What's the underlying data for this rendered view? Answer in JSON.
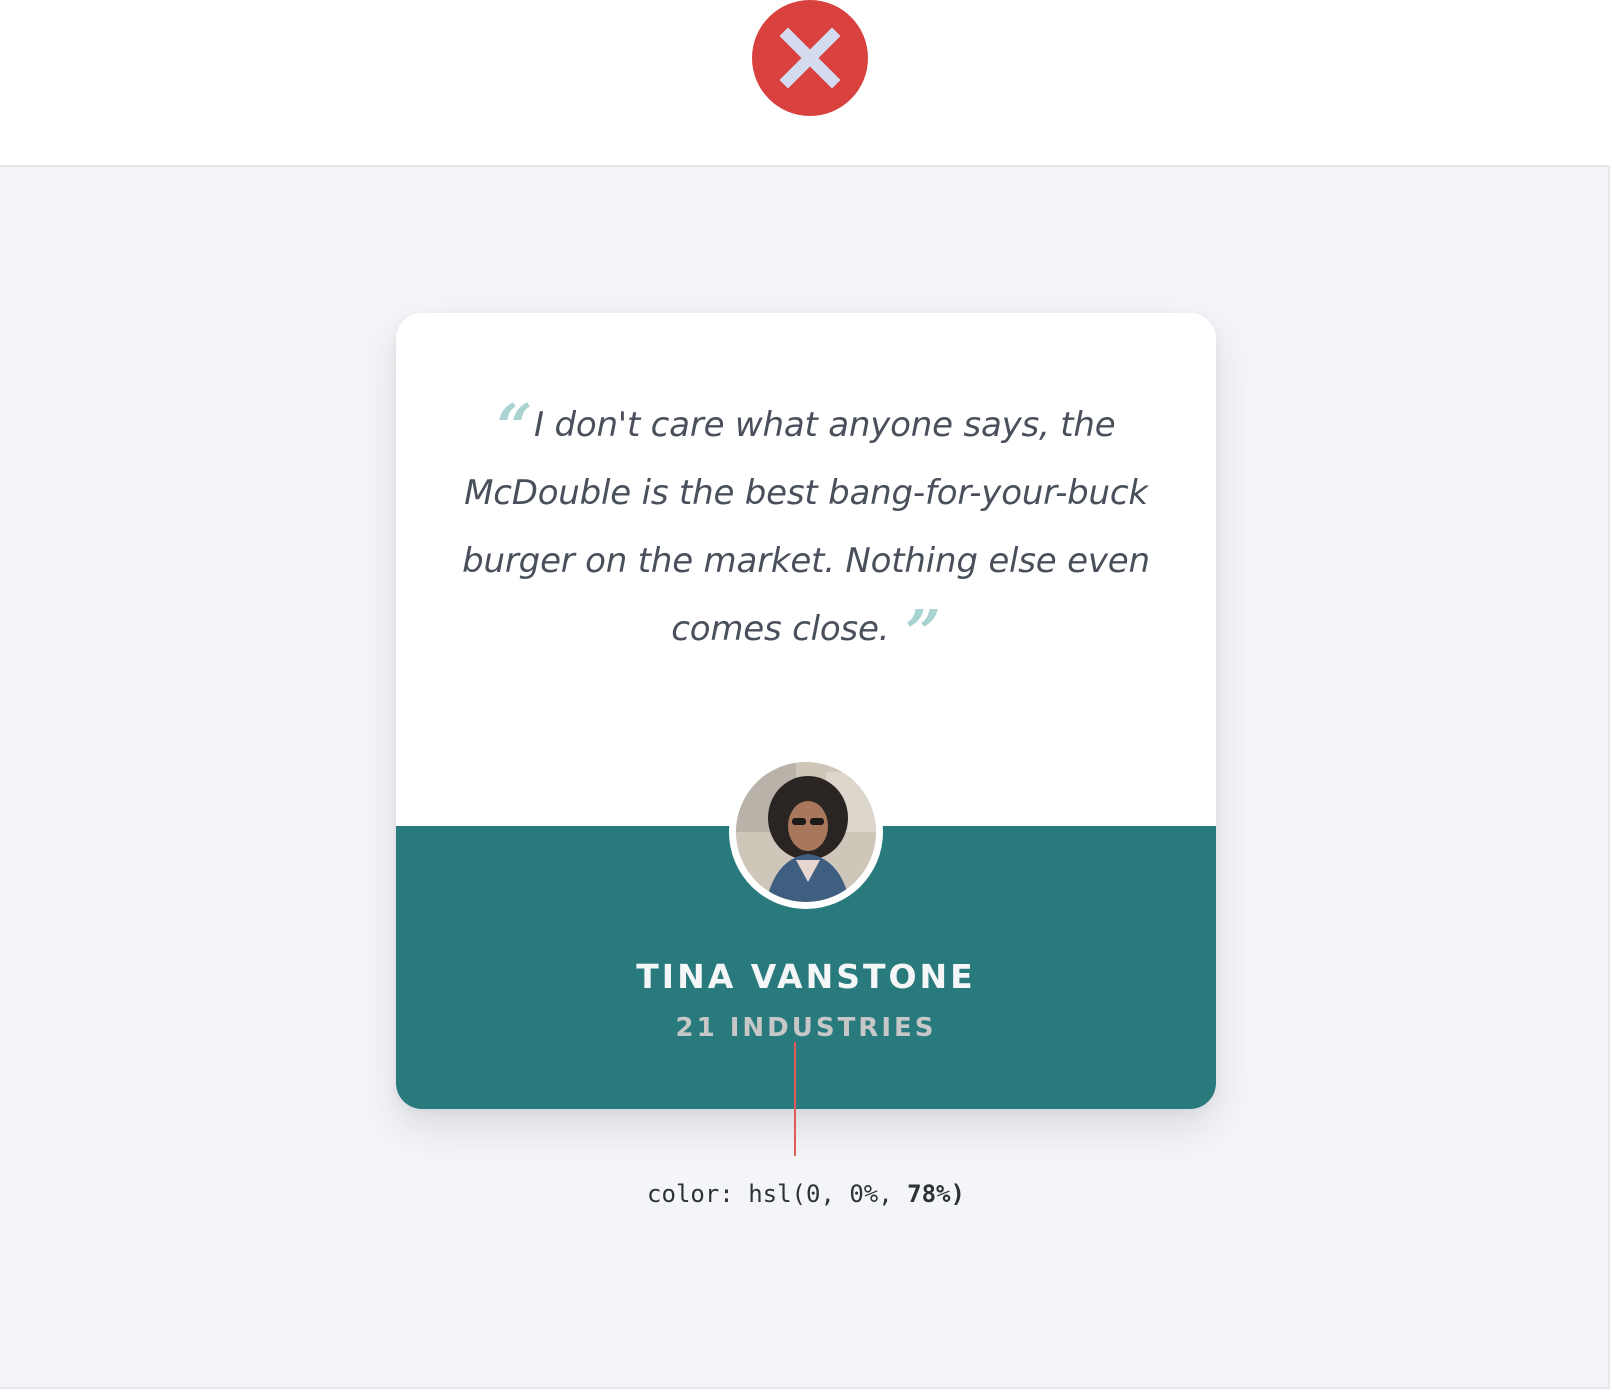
{
  "status_badge": {
    "icon": "close-icon",
    "color": "#d9413e",
    "glyph_color": "#d5dcf0"
  },
  "testimonial": {
    "quote": "I don't care what anyone says, the McDouble is the best bang-for-your-buck burger on the market. Nothing else even comes close.",
    "quote_open_glyph": "“",
    "quote_close_glyph": "”",
    "name": "TINA VANSTONE",
    "company": "21 INDUSTRIES",
    "accent_color": "#297a7d",
    "quote_mark_color": "#a8d3d1"
  },
  "annotation": {
    "prefix": "color: hsl(0, 0%, ",
    "value": "78%)",
    "line_color": "#e25a5a"
  }
}
